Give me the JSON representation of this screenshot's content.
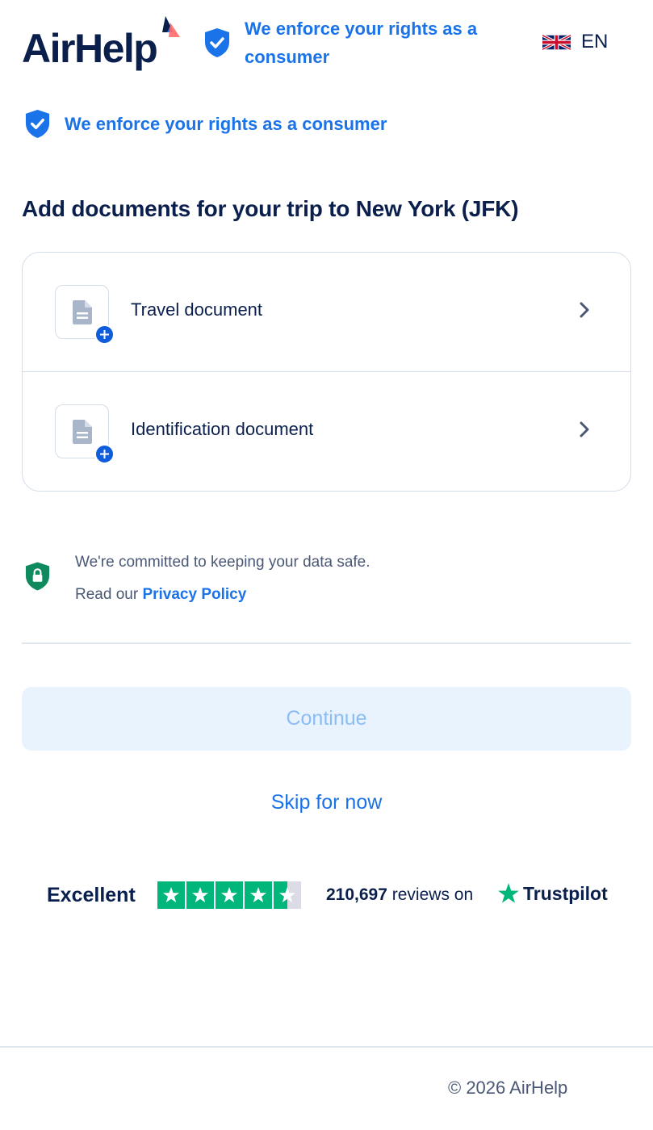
{
  "header": {
    "logo_text": "AirHelp",
    "tagline": "We enforce your rights as a consumer",
    "language": "EN",
    "flag_icon": "uk-flag-icon"
  },
  "rights_banner": {
    "text": "We enforce your rights as a consumer",
    "icon": "shield-check-icon"
  },
  "page": {
    "title": "Add documents for your trip to New York (JFK)"
  },
  "documents": [
    {
      "label": "Travel document",
      "icon": "document-icon",
      "action_icon": "chevron-right-icon"
    },
    {
      "label": "Identification document",
      "icon": "document-icon",
      "action_icon": "chevron-right-icon"
    }
  ],
  "privacy": {
    "line1": "We're committed to keeping your data safe.",
    "line2_prefix": "Read our ",
    "link_label": "Privacy Policy",
    "icon": "lock-shield-icon"
  },
  "actions": {
    "continue_label": "Continue",
    "skip_label": "Skip for now"
  },
  "trustpilot": {
    "rating_label": "Excellent",
    "stars": 4.5,
    "review_count": "210,697",
    "reviews_suffix": " reviews on",
    "brand": "Trustpilot"
  },
  "footer": {
    "copyright": "© 2026 AirHelp"
  },
  "colors": {
    "brand_navy": "#0b1f4d",
    "link_blue": "#1a73e8",
    "badge_blue": "#0d5ddc",
    "trustpilot_green": "#00b67a",
    "privacy_green": "#0f8a5f",
    "disabled_button_bg": "#e9f3fe",
    "disabled_button_text": "#8bbcf3"
  }
}
